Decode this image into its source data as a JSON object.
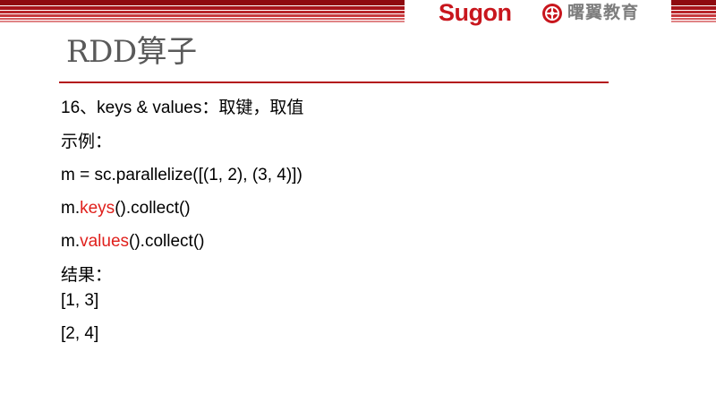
{
  "header": {
    "brand": "Sugon",
    "partner": "曙翼教育"
  },
  "slide": {
    "title": "RDD算子",
    "heading": "16、keys & values：取键，取值",
    "example_label": "示例：",
    "code": {
      "line1": "m = sc.parallelize([(1, 2), (3, 4)])",
      "line2_prefix": "m.",
      "line2_highlight": "keys",
      "line2_suffix": "().collect()",
      "line3_prefix": "m.",
      "line3_highlight": "values",
      "line3_suffix": "().collect()"
    },
    "result_label": "结果：",
    "results": [
      "[1, 3]",
      "[2, 4]"
    ]
  },
  "colors": {
    "brand_red": "#c8161d",
    "highlight_red": "#e0201c",
    "title_gray": "#5a5a5a"
  }
}
